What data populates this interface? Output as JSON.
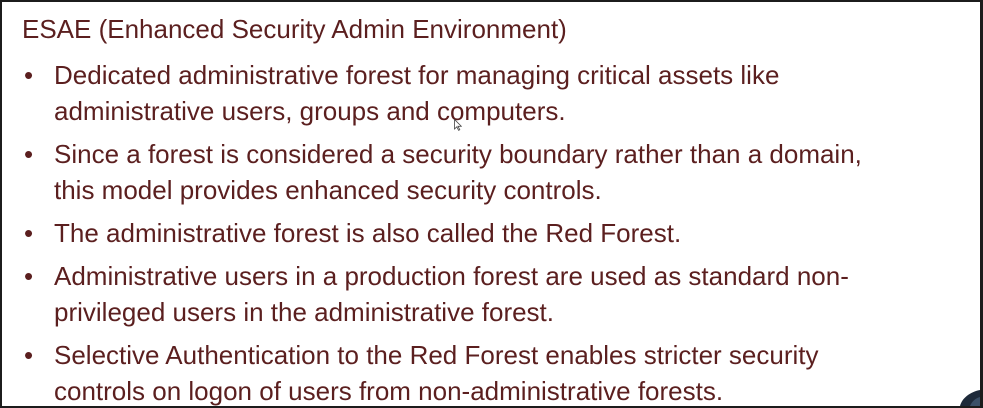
{
  "slide": {
    "title": "ESAE (Enhanced Security Admin Environment)",
    "bullet_glyph": "•",
    "bullets": [
      {
        "line1": "Dedicated administrative forest for managing critical assets like",
        "line2": "administrative users, groups and computers."
      },
      {
        "line1": "Since a forest is considered a security boundary rather than a domain,",
        "line2": "this model provides enhanced security controls."
      },
      {
        "line1": "The administrative forest is also called the Red Forest.",
        "line2": ""
      },
      {
        "line1": "Administrative users in a production forest are used as standard non-",
        "line2": "privileged users in the administrative forest."
      },
      {
        "line1": "Selective Authentication to the Red Forest enables stricter security",
        "line2": "controls on logon of users from non-administrative forests."
      }
    ]
  },
  "icons": {
    "cursor": "mouse-pointer-icon",
    "corner": "decorative-corner-icon"
  },
  "colors": {
    "text": "#5b1f1f",
    "border": "#1c1c1c",
    "background": "#ffffff"
  }
}
